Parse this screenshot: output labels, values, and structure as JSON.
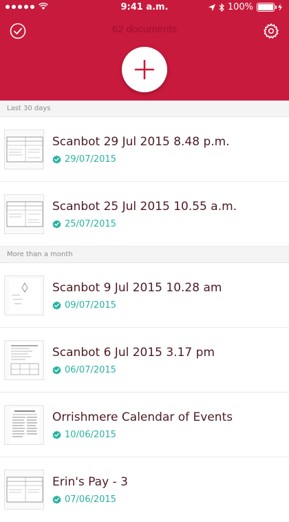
{
  "status_bar": {
    "carrier_signal": "signal-dots",
    "wifi": "wifi-icon",
    "time": "9:41 a.m.",
    "battery_percent": "100%"
  },
  "header": {
    "title": "62 documents",
    "left_icon": "checkmark-circle-icon",
    "right_icon": "gear-icon",
    "add_icon": "plus-icon"
  },
  "sections": [
    {
      "label": "Last 30 days",
      "items": [
        {
          "title": "Scanbot 29 Jul 2015 8.48 p.m.",
          "date": "29/07/2015"
        },
        {
          "title": "Scanbot 25 Jul 2015 10.55 a.m.",
          "date": "25/07/2015"
        }
      ]
    },
    {
      "label": "More than a month",
      "items": [
        {
          "title": "Scanbot 9 Jul 2015 10.28 am",
          "date": "09/07/2015"
        },
        {
          "title": "Scanbot 6 Jul 2015 3.17 pm",
          "date": "06/07/2015"
        },
        {
          "title": "Orrishmere Calendar of Events",
          "date": "10/06/2015"
        },
        {
          "title": "Erin's Pay - 3",
          "date": "07/06/2015"
        }
      ]
    }
  ],
  "colors": {
    "brand": "#c81a3c",
    "date_teal": "#29b3a0",
    "title": "#4d1a22"
  }
}
